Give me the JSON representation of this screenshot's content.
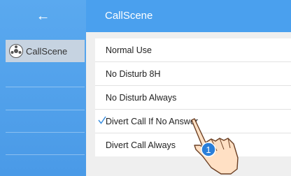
{
  "sidebar": {
    "back_icon": "←",
    "items": [
      {
        "label": "CallScene",
        "icon": "scene-dial-icon"
      }
    ]
  },
  "header": {
    "title": "CallScene"
  },
  "menu": {
    "items": [
      {
        "label": "Normal Use",
        "selected": false
      },
      {
        "label": "No Disturb 8H",
        "selected": false
      },
      {
        "label": "No Disturb Always",
        "selected": false
      },
      {
        "label": "Divert Call If No Answer",
        "selected": true
      },
      {
        "label": "Divert Call Always",
        "selected": false
      }
    ]
  },
  "overlay": {
    "step_number": "1"
  },
  "colors": {
    "accent": "#4aa0ee",
    "sidebar": "#5aa9ef",
    "check": "#3b8fe0",
    "step_badge": "#2b7fd9"
  }
}
